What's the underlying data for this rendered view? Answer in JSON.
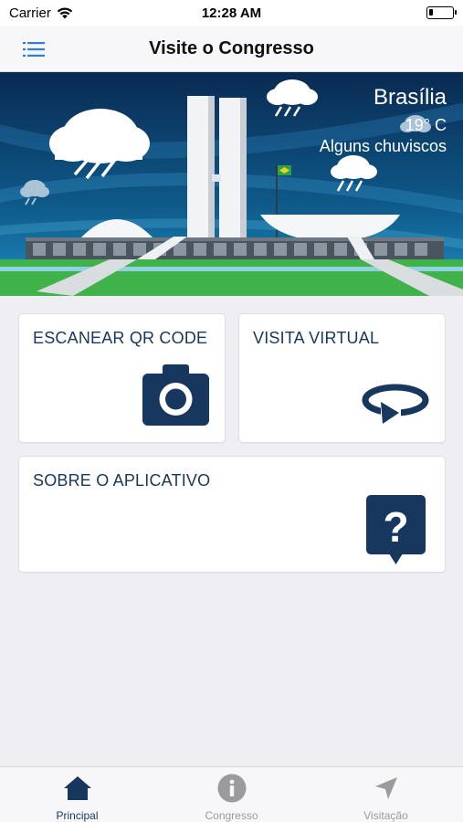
{
  "status_bar": {
    "carrier": "Carrier",
    "time": "12:28 AM"
  },
  "nav": {
    "title": "Visite o Congresso",
    "menu_icon": "list-icon"
  },
  "weather": {
    "city": "Brasília",
    "temperature": "19° C",
    "condition": "Alguns chuviscos"
  },
  "cards": {
    "qr": {
      "label": "ESCANEAR QR CODE",
      "icon": "camera-icon"
    },
    "virtual": {
      "label": "VISITA VIRTUAL",
      "icon": "rotate-360-icon"
    },
    "about": {
      "label": "SOBRE O APLICATIVO",
      "icon": "question-bubble-icon"
    }
  },
  "tabs": [
    {
      "label": "Principal",
      "icon": "home-icon",
      "active": true
    },
    {
      "label": "Congresso",
      "icon": "info-icon",
      "active": false
    },
    {
      "label": "Visitação",
      "icon": "location-arrow-icon",
      "active": false
    }
  ],
  "colors": {
    "brand": "#17375e",
    "inactive": "#9a9a9f",
    "sky_top": "#0a2a52",
    "grass": "#3fb24a"
  }
}
